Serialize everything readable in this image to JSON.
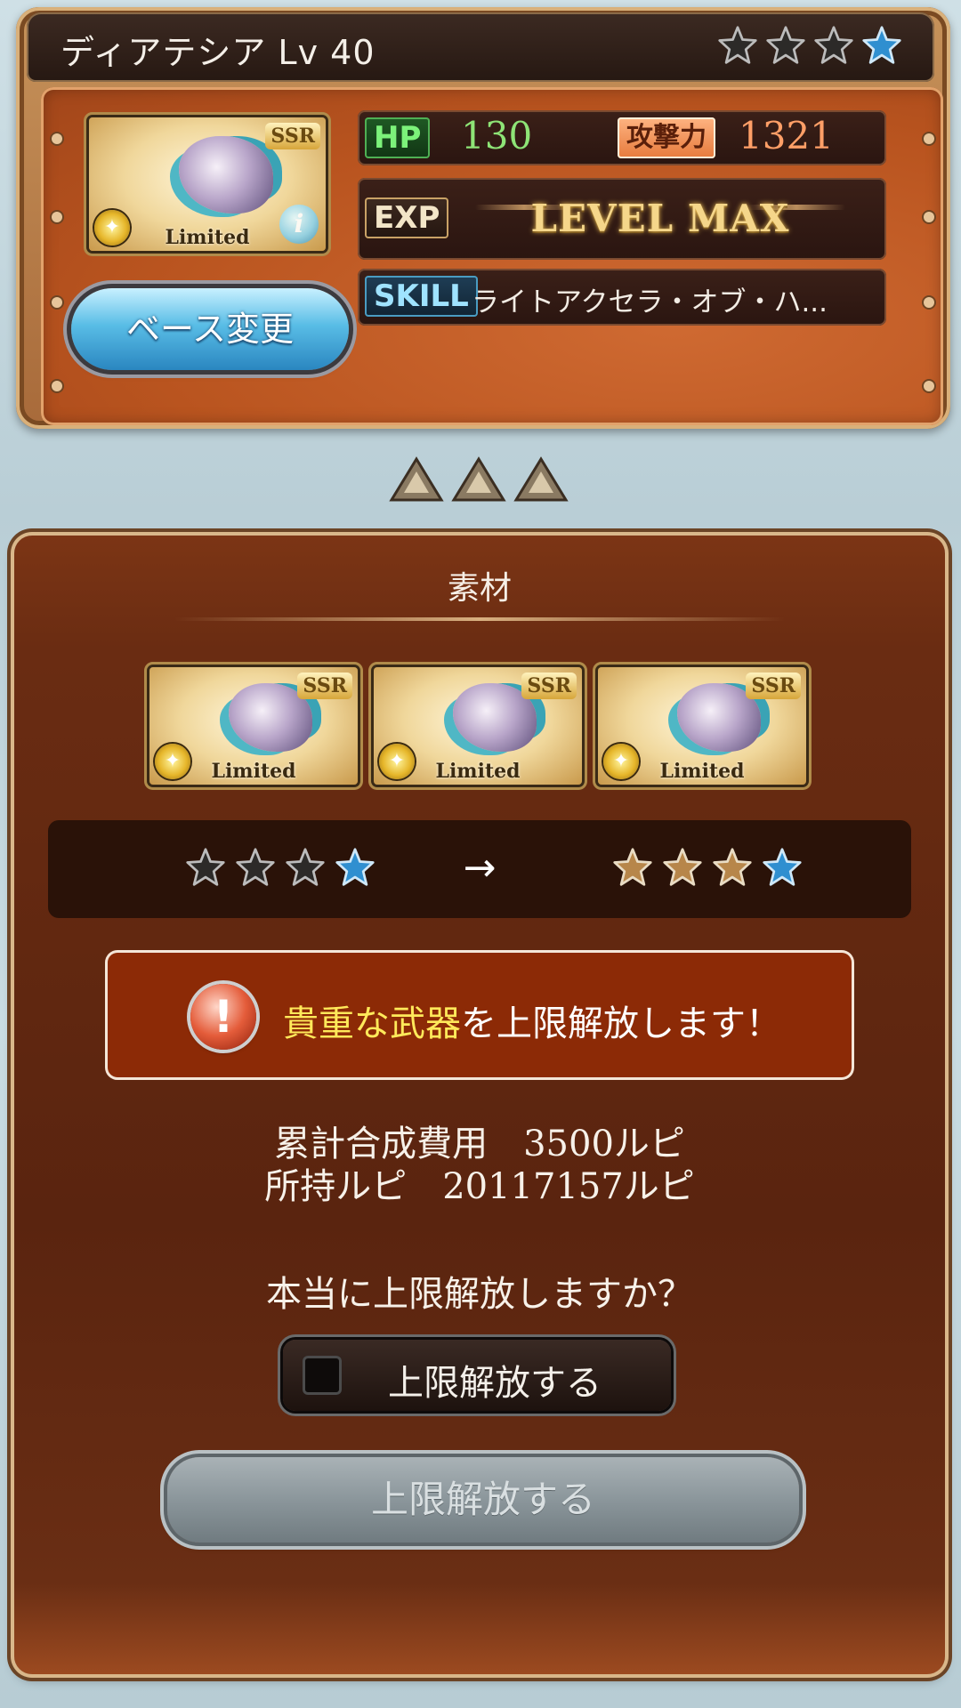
{
  "header": {
    "name": "ディアテシア Lv 40",
    "stars": [
      "gray",
      "gray",
      "gray",
      "blue"
    ]
  },
  "card": {
    "ssr_label": "SSR",
    "limited_label": "Limited",
    "info_label": "i"
  },
  "stats": {
    "hp_label": "HP",
    "hp_value": "130",
    "atk_label": "攻撃力",
    "atk_value": "1321",
    "exp_label": "EXP",
    "level_max": "LEVEL MAX",
    "skill_label": "SKILL",
    "skill_value": "ライトアクセラ・オブ・ハ..."
  },
  "buttons": {
    "base_change": "ベース変更"
  },
  "panel": {
    "title": "素材",
    "materials": [
      {
        "ssr": "SSR",
        "limited": "Limited"
      },
      {
        "ssr": "SSR",
        "limited": "Limited"
      },
      {
        "ssr": "SSR",
        "limited": "Limited"
      }
    ],
    "rank_before": [
      "gray",
      "gray",
      "gray",
      "blue"
    ],
    "rank_arrow": "→",
    "rank_after": [
      "gold",
      "gold",
      "gold",
      "blue"
    ],
    "warning_highlight": "貴重な武器",
    "warning_rest": "を上限解放します！",
    "warning_icon": "!",
    "cost_line": "累計合成費用　3500ルピ",
    "owned_line": "所持ルピ　20117157ルピ",
    "confirm_question": "本当に上限解放しますか？",
    "checkbox_label": "上限解放する",
    "submit_label": "上限解放する"
  },
  "colors": {
    "accent_blue": "#3a9bd1",
    "hp_green": "#8ee476",
    "atk_orange": "#ff9f67",
    "warning_yellow": "#ffe95a"
  }
}
